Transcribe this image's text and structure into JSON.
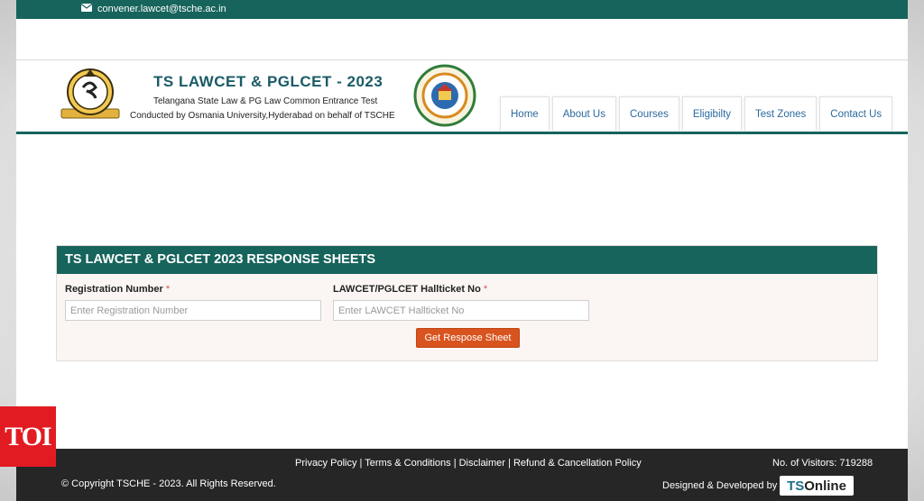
{
  "topbar": {
    "email": "convener.lawcet@tsche.ac.in",
    "icon": "mail-icon"
  },
  "header": {
    "title": "TS LAWCET & PGLCET - 2023",
    "subtitle": "Telangana State Law & PG Law Common Entrance Test",
    "conducted_by": "Conducted by Osmania University,Hyderabad on behalf of TSCHE"
  },
  "nav": {
    "items": [
      {
        "label": "Home"
      },
      {
        "label": "About Us"
      },
      {
        "label": "Courses"
      },
      {
        "label": "Eligibilty"
      },
      {
        "label": "Test Zones"
      },
      {
        "label": "Contact Us"
      }
    ]
  },
  "form": {
    "heading": "TS LAWCET & PGLCET 2023 RESPONSE SHEETS",
    "reg_label": "Registration Number",
    "reg_placeholder": "Enter Registration Number",
    "hall_label": "LAWCET/PGLCET Hallticket No",
    "hall_placeholder": "Enter LAWCET Hallticket No",
    "required_mark": "*",
    "submit_label": "Get Respose Sheet"
  },
  "watermark": {
    "text": "TOI"
  },
  "footer": {
    "links": [
      "Privacy Policy",
      "Terms & Conditions",
      "Disclaimer",
      "Refund & Cancellation Policy"
    ],
    "separator": "|",
    "visitors": "No. of Visitors: 719288",
    "copyright": "© Copyright TSCHE - 2023. All Rights Reserved.",
    "designed_by": "Designed & Developed by",
    "brand_ts": "TS",
    "brand_online": "Online"
  },
  "colors": {
    "primary": "#17645c",
    "button": "#d9531e",
    "footer": "#262626",
    "nav_text": "#2c6a9e",
    "required": "#d9534f"
  }
}
